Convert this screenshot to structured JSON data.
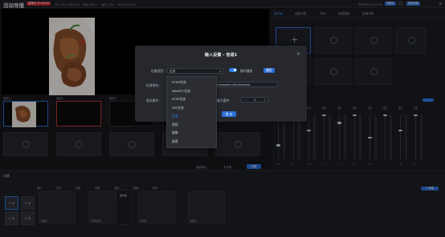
{
  "app": {
    "title": "活动导播",
    "live_badge": "直播中 00:00:00"
  },
  "topbar": {
    "info1": "CPU 12%  内存 35%",
    "info2": "网络 0KB/s",
    "info3": "画质 720p",
    "info4": "节目 00:00:00",
    "right_info": "预约时间 00:00:00",
    "btn1": "导播台",
    "btn2": "推流设置"
  },
  "right_panel": {
    "tabs": [
      "画中画",
      "画面切换",
      "图片",
      "音频播放",
      "直播功能"
    ],
    "add_glyph": "+"
  },
  "channels": [
    {
      "label": "信道1"
    },
    {
      "label": "信道2"
    },
    {
      "label": "信道3"
    },
    {
      "label": "信道4"
    }
  ],
  "channel_footer": {
    "a": "画面输出",
    "b": "无效果",
    "c": "切换"
  },
  "mixer": {
    "title": "音频混音器",
    "values": [
      "-20",
      "0",
      "-10",
      "0",
      "-5",
      "0",
      "-15",
      "0",
      "-10",
      "0"
    ]
  },
  "bottom": {
    "title": "场景",
    "add_label": "+ 新建",
    "scenes": [
      "A 场",
      "B 场",
      "C 场",
      "D 场"
    ],
    "tools": [
      "图片",
      "文字",
      "字幕",
      "视频",
      "音频",
      "直播",
      "特效"
    ],
    "timeline": [
      "画面1",
      "切换场景",
      "画面2",
      "画面3"
    ],
    "pip_label": "画中画"
  },
  "modal": {
    "title": "输入设置 - 信道1",
    "close_glyph": "×",
    "type_label": "信道类型：",
    "type_value": "拉流",
    "loop_label": "循环播放",
    "apply_label": "确定",
    "url_label": "拉流地址：",
    "url_value": "rtmp://example.com/live/test",
    "delay_label": "首次缓冲：",
    "max_buffer_label": "最大缓冲：",
    "max_buffer_value": "3",
    "confirm_label": "保 存"
  },
  "dropdown": {
    "items": [
      "RTMP拉流",
      "WebRTC拉流",
      "RTSP拉流",
      "SRT拉流",
      "拉流",
      "视频",
      "摄像",
      "屏幕"
    ],
    "selected_index": 4
  },
  "colors": {
    "accent": "#2f6fd8",
    "live": "#c0282f",
    "bg": "#17181c"
  }
}
